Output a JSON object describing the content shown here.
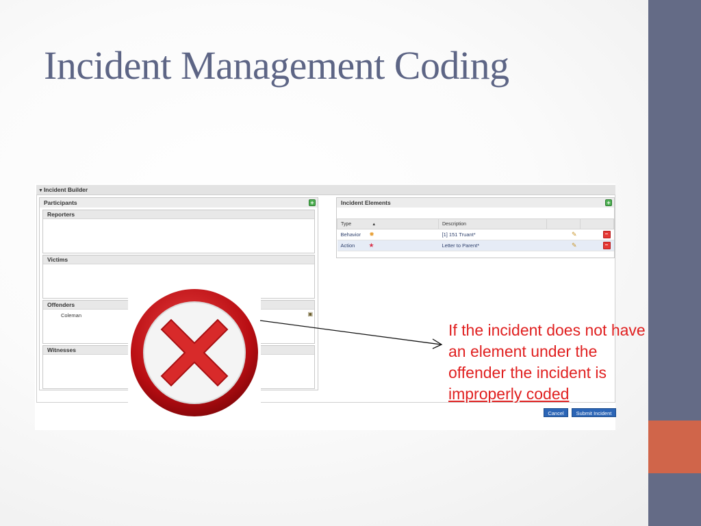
{
  "slide": {
    "title": "Incident Management Coding",
    "colors": {
      "title": "#5d6585",
      "sidebar": "#646b86",
      "accent": "#d0654a",
      "note": "#e02020"
    }
  },
  "incident_builder": {
    "header": "Incident Builder",
    "participants": {
      "title": "Participants",
      "add_icon": "add-icon",
      "sections": {
        "reporters": "Reporters",
        "victims": "Victims",
        "offenders": "Offenders",
        "witnesses": "Witnesses"
      },
      "offender_name": "Coleman"
    },
    "elements": {
      "title": "Incident Elements",
      "columns": {
        "type": "Type",
        "description": "Description"
      },
      "rows": [
        {
          "type": "Behavior",
          "description": "[1] 151 Truant*",
          "icon": "behavior-icon"
        },
        {
          "type": "Action",
          "description": "Letter to Parent*",
          "icon": "action-icon"
        }
      ]
    },
    "buttons": {
      "cancel": "Cancel",
      "submit": "Submit Incident"
    }
  },
  "overlay": {
    "icon": "error-x-icon",
    "note_prefix": "If the incident does not have an element under the offender the incident is ",
    "note_underlined": "improperly coded"
  }
}
